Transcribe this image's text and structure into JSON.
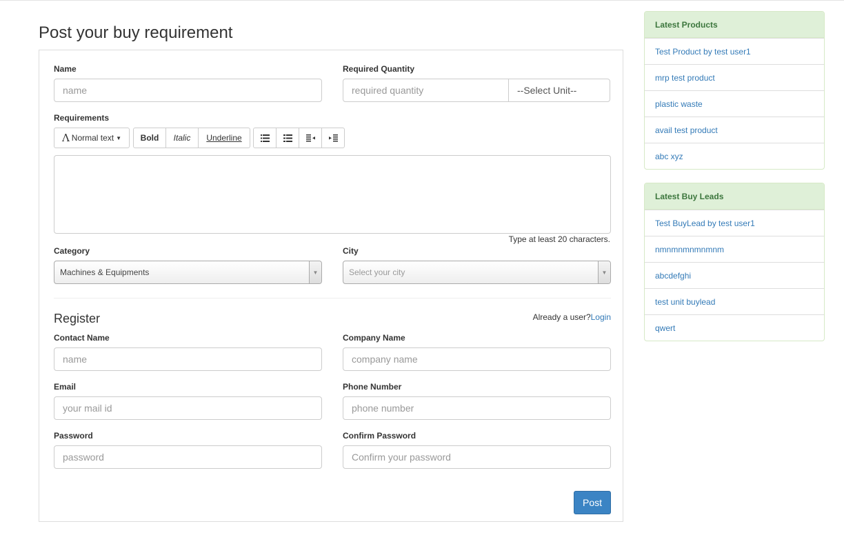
{
  "page": {
    "title": "Post your buy requirement"
  },
  "form": {
    "name": {
      "label": "Name",
      "placeholder": "name"
    },
    "quantity": {
      "label": "Required Quantity",
      "placeholder": "required quantity",
      "unit": "--Select Unit--"
    },
    "requirements": {
      "label": "Requirements",
      "toolbar": {
        "text_style": "Normal text",
        "bold": "Bold",
        "italic": "Italic",
        "underline": "Underline"
      },
      "hint": "Type at least 20 characters."
    },
    "category": {
      "label": "Category",
      "value": "Machines & Equipments"
    },
    "city": {
      "label": "City",
      "placeholder": "Select your city"
    }
  },
  "register": {
    "title": "Register",
    "already_user": "Already a user?",
    "login": "Login",
    "contact_name": {
      "label": "Contact Name",
      "placeholder": "name"
    },
    "company_name": {
      "label": "Company Name",
      "placeholder": "company name"
    },
    "email": {
      "label": "Email",
      "placeholder": "your mail id"
    },
    "phone": {
      "label": "Phone Number",
      "placeholder": "phone number"
    },
    "password": {
      "label": "Password",
      "placeholder": "password"
    },
    "confirm_password": {
      "label": "Confirm Password",
      "placeholder": "Confirm your password"
    },
    "post_button": "Post"
  },
  "sidebar": {
    "latest_products": {
      "title": "Latest Products",
      "items": [
        "Test Product by test user1",
        "mrp test product",
        "plastic waste",
        "avail test product",
        "abc xyz"
      ]
    },
    "latest_buy_leads": {
      "title": "Latest Buy Leads",
      "items": [
        "Test BuyLead by test user1",
        "nmnmnmnmnmnm",
        "abcdefghi",
        "test unit buylead",
        "qwert"
      ]
    },
    "colors": {
      "header_bg": "#dff0d8",
      "header_text": "#3c763d",
      "link": "#337ab7",
      "primary_button": "#3b84c4"
    }
  }
}
